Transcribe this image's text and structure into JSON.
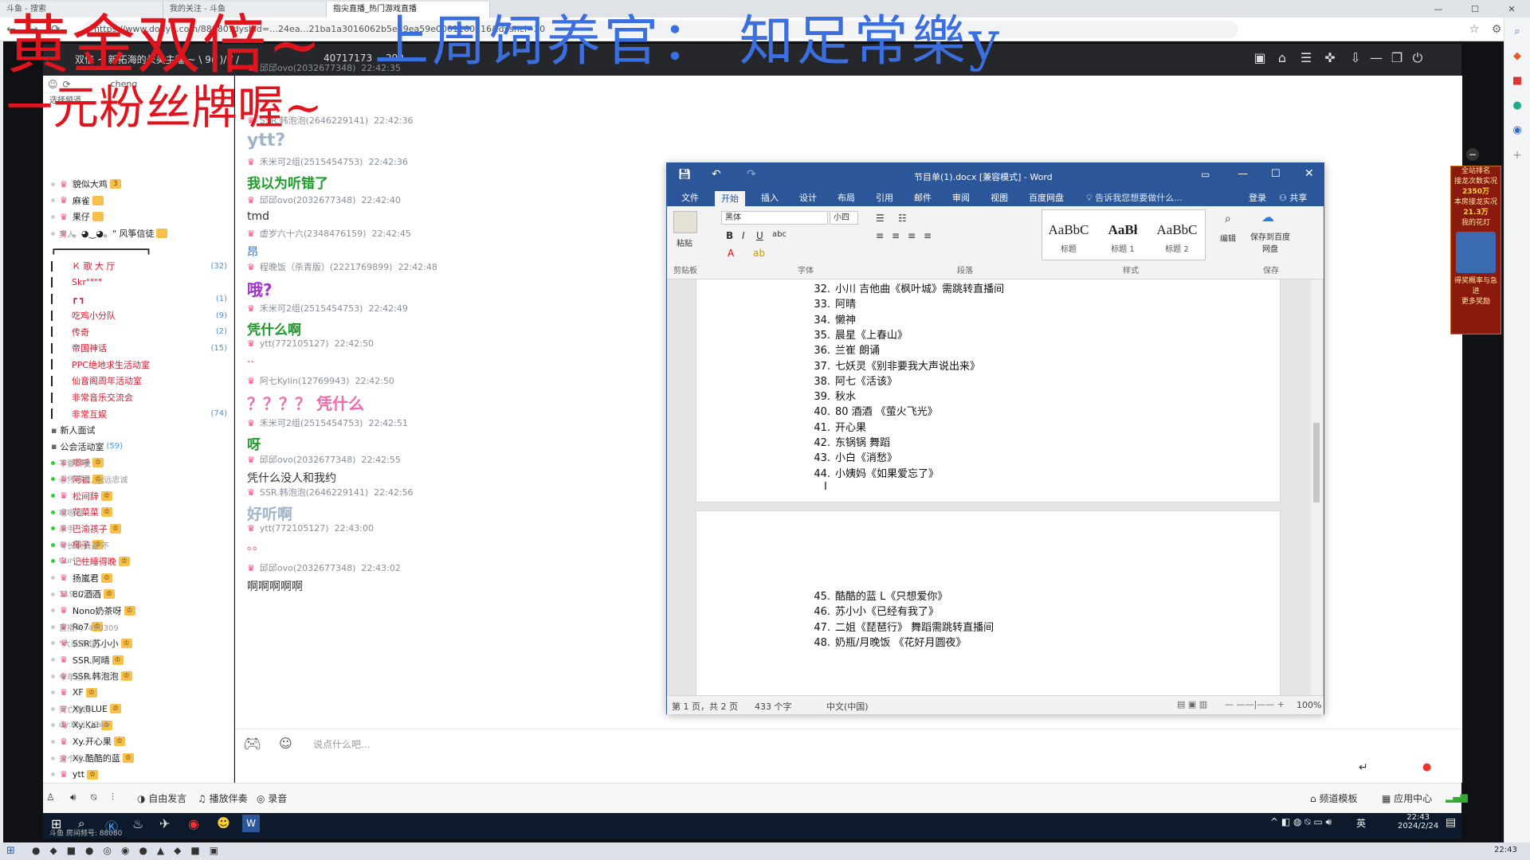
{
  "browser": {
    "tabs": [
      "斗鱼 - 搜索",
      "我的关注 - 斗鱼",
      "指尖直播_热门游戏直播"
    ],
    "url": "https://www.douyu.com/88080?dyshid=…24ea…21ba1a3016062b5e39ea59e0001160116&dyshci=20",
    "window_controls": [
      "—",
      "☐",
      "✕"
    ]
  },
  "overlay": {
    "line1_red": "黄金双倍~",
    "line1_blue": "上周饲养官： 知足常樂y",
    "line2_red": "一元粉丝牌喔~"
  },
  "stream_header": {
    "title": "双倍 ~ 新拓海的长美主播 ~ \\ 9(`)/ / /",
    "viewers": "40717173",
    "fans": "290"
  },
  "sidebar": {
    "search_value": "cheng",
    "channel_label": "选择频道",
    "users_top": [
      {
        "name": "貌似大鸡",
        "badge": "3"
      },
      {
        "name": "麻雀",
        "badge": ""
      },
      {
        "name": "果仔",
        "badge": ""
      },
      {
        "name": "。◕‿◕。\" 风筝信徒",
        "badge": "",
        "msg": "男人"
      }
    ],
    "groups": [
      {
        "name": "Ｋ 歌 大 厅",
        "count": "(32)"
      },
      {
        "name": "Skr\"\"\"\"",
        "count": ""
      },
      {
        "name": "┏ ┓",
        "count": "(1)"
      },
      {
        "name": "吃鸡小分队",
        "count": "(9)"
      },
      {
        "name": "传奇",
        "count": "(2)"
      },
      {
        "name": "帝国神话",
        "count": "(15)"
      },
      {
        "name": "PPC绝地求生活动室",
        "count": ""
      },
      {
        "name": "仙音阁周年活动室",
        "count": ""
      },
      {
        "name": "非常音乐交流会",
        "count": ""
      },
      {
        "name": "非常互娱",
        "count": "(74)"
      }
    ],
    "sections": [
      {
        "name": "新人面试",
        "count": ""
      },
      {
        "name": "公会活动室",
        "count": "(59)"
      }
    ],
    "members": [
      {
        "name": "唧呼",
        "msg": "不要帮我",
        "red": true
      },
      {
        "name": "阿福",
        "msg": "心怀感恩, 永远忠诚",
        "red": true
      },
      {
        "name": "松间辞",
        "msg": "",
        "red": true
      },
      {
        "name": "花菜菜",
        "msg": "嗯嗯嗯",
        "red": true
      },
      {
        "name": "巴渝孩子",
        "msg": "杀手",
        "red": true
      },
      {
        "name": "椰子",
        "msg": "号长期捕盗 不",
        "red": true
      },
      {
        "name": "记住睡得晚",
        "msg": "Cur I a",
        "red": true
      },
      {
        "name": "扬嵐君",
        "msg": "",
        "red": false
      },
      {
        "name": "80酒酒",
        "msg": "11917755",
        "red": false
      },
      {
        "name": "Nono奶茶呀",
        "msg": "",
        "red": false
      },
      {
        "name": "Ro7",
        "msg": "直播间: 490309",
        "red": false
      },
      {
        "name": "SSR.苏小小",
        "msg": "\"大杀四方\" ",
        "red": false
      },
      {
        "name": "SSR.阿晴",
        "msg": "",
        "red": false
      },
      {
        "name": "SSR.韩泡泡",
        "msg": "今年刚满",
        "red": false
      },
      {
        "name": "XF",
        "msg": "",
        "red": false
      },
      {
        "name": "Xy.BLUE",
        "msg": "死亡真情",
        "red": false
      },
      {
        "name": "Xy.Kai",
        "msg": "dy:Kaiii_Kaiii",
        "red": false
      },
      {
        "name": "Xy.开心果",
        "msg": "",
        "red": false
      },
      {
        "name": "Xy.酷酷的蓝",
        "msg": "这个号",
        "red": false
      },
      {
        "name": "ytt",
        "msg": "",
        "red": false
      }
    ]
  },
  "chat": {
    "messages": [
      {
        "user": "邱邱ovo(2032677348)",
        "time": "22:42:35",
        "text": "?",
        "color": "#333"
      },
      {
        "user": "SSR.韩泡泡(2646229141)",
        "time": "22:42:36",
        "text": "ytt?",
        "color": "#9fb4c8"
      },
      {
        "user": "禾米可2组(2515454753)",
        "time": "22:42:36",
        "text": "我以为听错了",
        "color": "#1c9a2a"
      },
      {
        "user": "邱邱ovo(2032677348)",
        "time": "22:42:40",
        "text": "tmd",
        "color": "#333"
      },
      {
        "user": "虚岁六十六(2348476159)",
        "time": "22:42:45",
        "text": "昂",
        "color": "#2f6fd1"
      },
      {
        "user": "程晚饭（杀青版）(2221769899)",
        "time": "22:42:48",
        "text": "哦?",
        "color": "#a236c9"
      },
      {
        "user": "禾米可2组(2515454753)",
        "time": "22:42:49",
        "text": "凭什么啊",
        "color": "#1c9a2a"
      },
      {
        "user": "ytt(772105127)",
        "time": "22:42:50",
        "text": "..",
        "color": "#e0467a"
      },
      {
        "user": "阿七Kylin(12769943)",
        "time": "22:42:50",
        "text": "？？？？ 凭什么",
        "color": "#f06aa8"
      },
      {
        "user": "禾米可2组(2515454753)",
        "time": "22:42:51",
        "text": "呀",
        "color": "#1c9a2a"
      },
      {
        "user": "邱邱ovo(2032677348)",
        "time": "22:42:55",
        "text": "凭什么没人和我约",
        "color": "#333"
      },
      {
        "user": "SSR.韩泡泡(2646229141)",
        "time": "22:42:56",
        "text": "好听啊",
        "color": "#9fb4c8"
      },
      {
        "user": "ytt(772105127)",
        "time": "22:43:00",
        "text": "。。",
        "color": "#e0467a"
      },
      {
        "user": "邱邱ovo(2032677348)",
        "time": "22:43:02",
        "text": "啊啊啊啊啊",
        "color": "#333"
      }
    ],
    "input_placeholder": "说点什么吧..."
  },
  "bottom_toolbar": {
    "free_speak": "自由发言",
    "accompany": "播放伴奏",
    "record": "录音",
    "channel_template": "频道模板",
    "app_center": "应用中心",
    "room_id": "斗鱼 房间频号: 88080"
  },
  "word": {
    "title": "节目单(1).docx [兼容模式] - Word",
    "tabs": [
      "文件",
      "开始",
      "插入",
      "设计",
      "布局",
      "引用",
      "邮件",
      "审阅",
      "视图",
      "百度网盘"
    ],
    "tell_me": "告诉我您想要做什么...",
    "login": "登录",
    "share": "共享",
    "font_name": "黑体",
    "font_size": "小四",
    "paste": "粘贴",
    "group_clipboard": "剪贴板",
    "group_font": "字体",
    "group_paragraph": "段落",
    "group_styles": "样式",
    "group_save": "保存",
    "styles": [
      {
        "sample": "AaBbC",
        "caption": "标题"
      },
      {
        "sample": "AaBł",
        "caption": "标题 1"
      },
      {
        "sample": "AaBbC",
        "caption": "标题 2"
      }
    ],
    "edit_label": "编辑",
    "save_baidu": "保存到百度网盘",
    "lines_page1": [
      {
        "n": "32.",
        "t": "小川 吉他曲《枫叶城》需跳转直播间"
      },
      {
        "n": "33.",
        "t": "阿晴"
      },
      {
        "n": "34.",
        "t": "懒神"
      },
      {
        "n": "35.",
        "t": "晨星《上春山》"
      },
      {
        "n": "36.",
        "t": "兰崔   朗诵"
      },
      {
        "n": "37.",
        "t": "七妖灵《别非要我大声说出来》"
      },
      {
        "n": "38.",
        "t": "阿七《活该》"
      },
      {
        "n": "39.",
        "t": "秋水"
      },
      {
        "n": "40.",
        "t": "80 酒酒  《萤火飞光》"
      },
      {
        "n": "41.",
        "t": "开心果"
      },
      {
        "n": "42.",
        "t": "东锅锅      舞蹈"
      },
      {
        "n": "43.",
        "t": "小白《消愁》"
      },
      {
        "n": "44.",
        "t": "小姨妈《如果爱忘了》"
      }
    ],
    "lines_page2": [
      {
        "n": "45.",
        "t": "酷酷的蓝 L《只想爱你》"
      },
      {
        "n": "46.",
        "t": "苏小小《已经有我了》"
      },
      {
        "n": "47.",
        "t": "二姐《琵琶行》  舞蹈需跳转直播间"
      },
      {
        "n": "48.",
        "t": "奶瓶/月晚饭  《花好月圆夜》"
      }
    ],
    "status_pages": "第 1 页，共 2 页",
    "status_words": "433 个字",
    "status_lang": "中文(中国)",
    "zoom": "100%"
  },
  "gift_panel": {
    "line1": "全站排名",
    "line2": "接龙次数实况",
    "value1": "2350万",
    "line3": "本房接龙实况",
    "value2": "21.3万",
    "line4": "我的花灯",
    "line5": "得奖概率与急进",
    "line6": "更多奖励"
  },
  "taskbar": {
    "time": "22:43",
    "date": "2024/2/24",
    "ime": "英",
    "bottom_time": "22:43"
  }
}
